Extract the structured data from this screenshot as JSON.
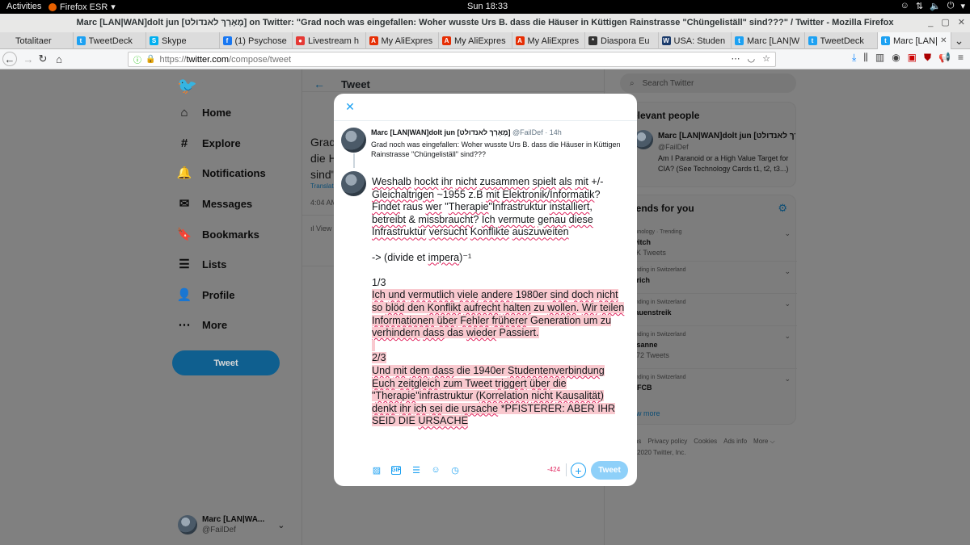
{
  "gnome": {
    "activities": "Activities",
    "app_menu": "Firefox ESR",
    "clock": "Sun 18:33"
  },
  "window": {
    "title": "Marc [LAN|WAN]dolt jun [מֶאֶרְךּ לאנדולט] on Twitter: \"Grad noch was eingefallen: Woher wusste Urs B. dass die Häuser in Küttigen Rainstrasse \"Chüngeliställ\" sind???\" / Twitter - Mozilla Firefox"
  },
  "tabs": [
    {
      "label": "Totalitaer",
      "fav_color": "#dcdcdc",
      "fav": ""
    },
    {
      "label": "TweetDeck",
      "fav_color": "#1da1f2",
      "fav": "t"
    },
    {
      "label": "Skype",
      "fav_color": "#00aff0",
      "fav": "S"
    },
    {
      "label": "(1) Psychose",
      "fav_color": "#1877f2",
      "fav": "f"
    },
    {
      "label": "Livestream h",
      "fav_color": "#e53935",
      "fav": "●"
    },
    {
      "label": "My AliExpres",
      "fav_color": "#e62e04",
      "fav": "A"
    },
    {
      "label": "My AliExpres",
      "fav_color": "#e62e04",
      "fav": "A"
    },
    {
      "label": "My AliExpres",
      "fav_color": "#e62e04",
      "fav": "A"
    },
    {
      "label": "Diaspora Eu",
      "fav_color": "#333333",
      "fav": "*"
    },
    {
      "label": "USA: Studen",
      "fav_color": "#1a3a6b",
      "fav": "W"
    },
    {
      "label": "Marc [LAN|W",
      "fav_color": "#1da1f2",
      "fav": "t"
    },
    {
      "label": "TweetDeck",
      "fav_color": "#1da1f2",
      "fav": "t"
    },
    {
      "label": "Marc [LAN|W",
      "fav_color": "#1da1f2",
      "fav": "t"
    }
  ],
  "active_tab_index": 12,
  "url": {
    "scheme": "https://",
    "host": "twitter.com",
    "path": "/compose/tweet"
  },
  "sidebar": {
    "items": [
      {
        "label": "Home",
        "icon": "⌂"
      },
      {
        "label": "Explore",
        "icon": "#"
      },
      {
        "label": "Notifications",
        "icon": "🔔"
      },
      {
        "label": "Messages",
        "icon": "✉"
      },
      {
        "label": "Bookmarks",
        "icon": "🔖"
      },
      {
        "label": "Lists",
        "icon": "☰"
      },
      {
        "label": "Profile",
        "icon": "👤"
      },
      {
        "label": "More",
        "icon": "⋯"
      }
    ],
    "tweet_button": "Tweet",
    "account_name": "Marc [LAN|WA...",
    "account_handle": "@FailDef"
  },
  "middle": {
    "header": "Tweet",
    "peek_lines": [
      "Grad",
      "die H",
      "sind\""
    ],
    "translate": "Translat",
    "time": "4:04 AM",
    "view": "View"
  },
  "right": {
    "search_placeholder": "Search Twitter",
    "relevant_title": "elevant people",
    "person_name": "Marc [LAN|WAN]dolt jun [מֶאֶרְךּ לאנדולט",
    "person_handle": "@FailDef",
    "person_bio": "Am I Paranoid or a High Value Target for CIA? (See Technology Cards t1, t2, t3...)",
    "trends_title": "rends for you",
    "trends": [
      {
        "context": "chnology · Trending",
        "name": "witch",
        "count": "7K Tweets"
      },
      {
        "context": "ending in Switzerland",
        "name": "ürich",
        "count": ""
      },
      {
        "context": "ending in Switzerland",
        "name": "rauenstreik",
        "count": ""
      },
      {
        "context": "ending in Switzerland",
        "name": "usanne",
        "count": "072 Tweets"
      },
      {
        "context": "ending in Switzerland",
        "name": "SFCB",
        "count": ""
      }
    ],
    "show_more": "ow more",
    "footer_links": [
      "rms",
      "Privacy policy",
      "Cookies",
      "Ads info",
      "More ⌵"
    ],
    "footer_copy": "2020 Twitter, Inc."
  },
  "modal": {
    "original_name": "Marc [LAN|WAN]dolt jun [מֶאֶרְךּ לאנדולט]",
    "original_handle": "@FailDef",
    "original_time": "14h",
    "original_text": "Grad noch was eingefallen: Woher wusste Urs B. dass die Häuser in Küttigen Rainstrasse \"Chüngeliställ\" sind???",
    "counter": "-424",
    "submit": "Tweet"
  }
}
